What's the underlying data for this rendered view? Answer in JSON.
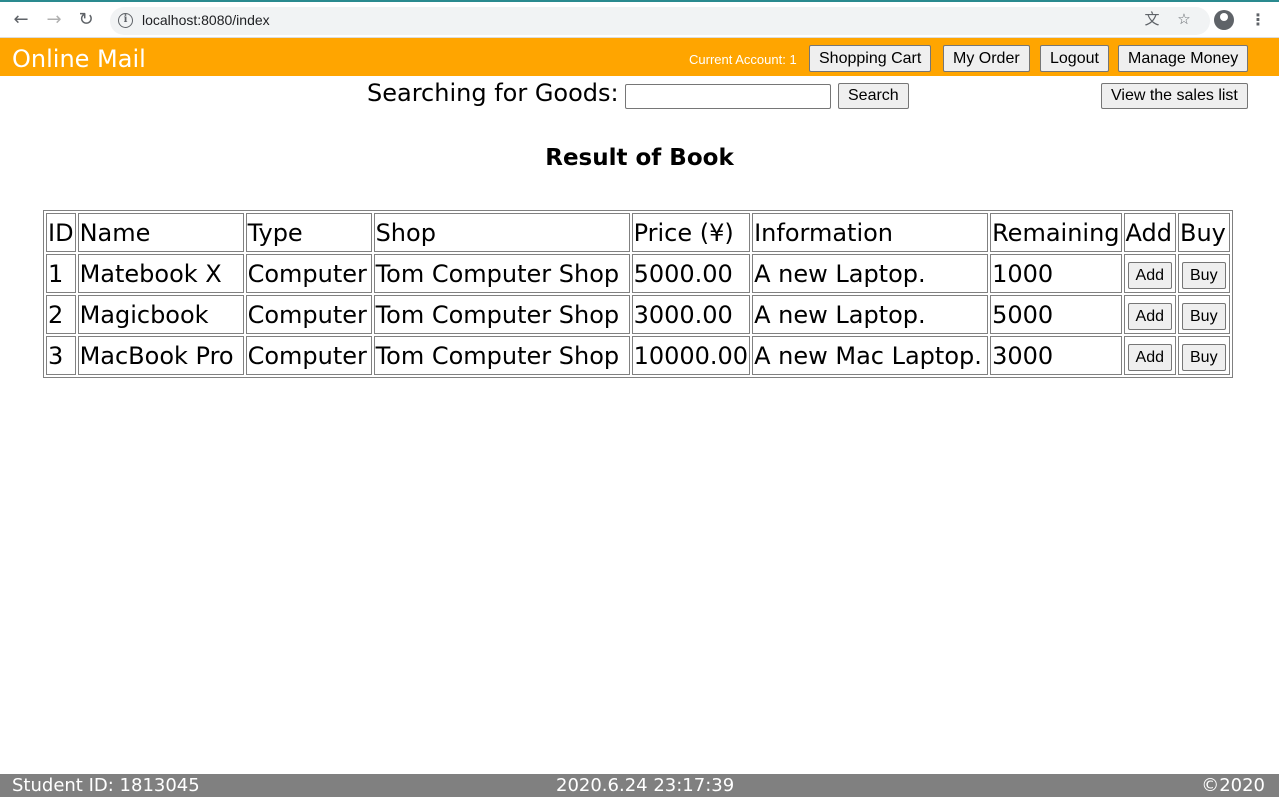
{
  "browser": {
    "url": "localhost:8080/index"
  },
  "header": {
    "brand": "Online Mail",
    "account_text": "Current Account: 1",
    "buttons": {
      "shopping_cart": "Shopping Cart",
      "my_order": "My Order",
      "logout": "Logout",
      "manage_money": "Manage Money"
    },
    "color": "#ffa500"
  },
  "search": {
    "label": "Searching for Goods:",
    "value": "",
    "button": "Search",
    "sales_list_button": "View the sales list"
  },
  "result_title": "Result of Book",
  "table": {
    "headers": [
      "ID",
      "Name",
      "Type",
      "Shop",
      "Price (¥)",
      "Information",
      "Remaining",
      "Add",
      "Buy"
    ],
    "rows": [
      {
        "id": "1",
        "name": "Matebook X",
        "type": "Computer",
        "shop": "Tom Computer Shop",
        "price": "5000.00",
        "info": "A new Laptop.",
        "remaining": "1000",
        "add": "Add",
        "buy": "Buy"
      },
      {
        "id": "2",
        "name": "Magicbook",
        "type": "Computer",
        "shop": "Tom Computer Shop",
        "price": "3000.00",
        "info": "A new Laptop.",
        "remaining": "5000",
        "add": "Add",
        "buy": "Buy"
      },
      {
        "id": "3",
        "name": "MacBook Pro",
        "type": "Computer",
        "shop": "Tom Computer Shop",
        "price": "10000.00",
        "info": "A new Mac Laptop.",
        "remaining": "3000",
        "add": "Add",
        "buy": "Buy"
      }
    ]
  },
  "footer": {
    "student_id": "Student ID: 1813045",
    "datetime": "2020.6.24 23:17:39",
    "copyright": "©2020",
    "color": "#808080"
  }
}
